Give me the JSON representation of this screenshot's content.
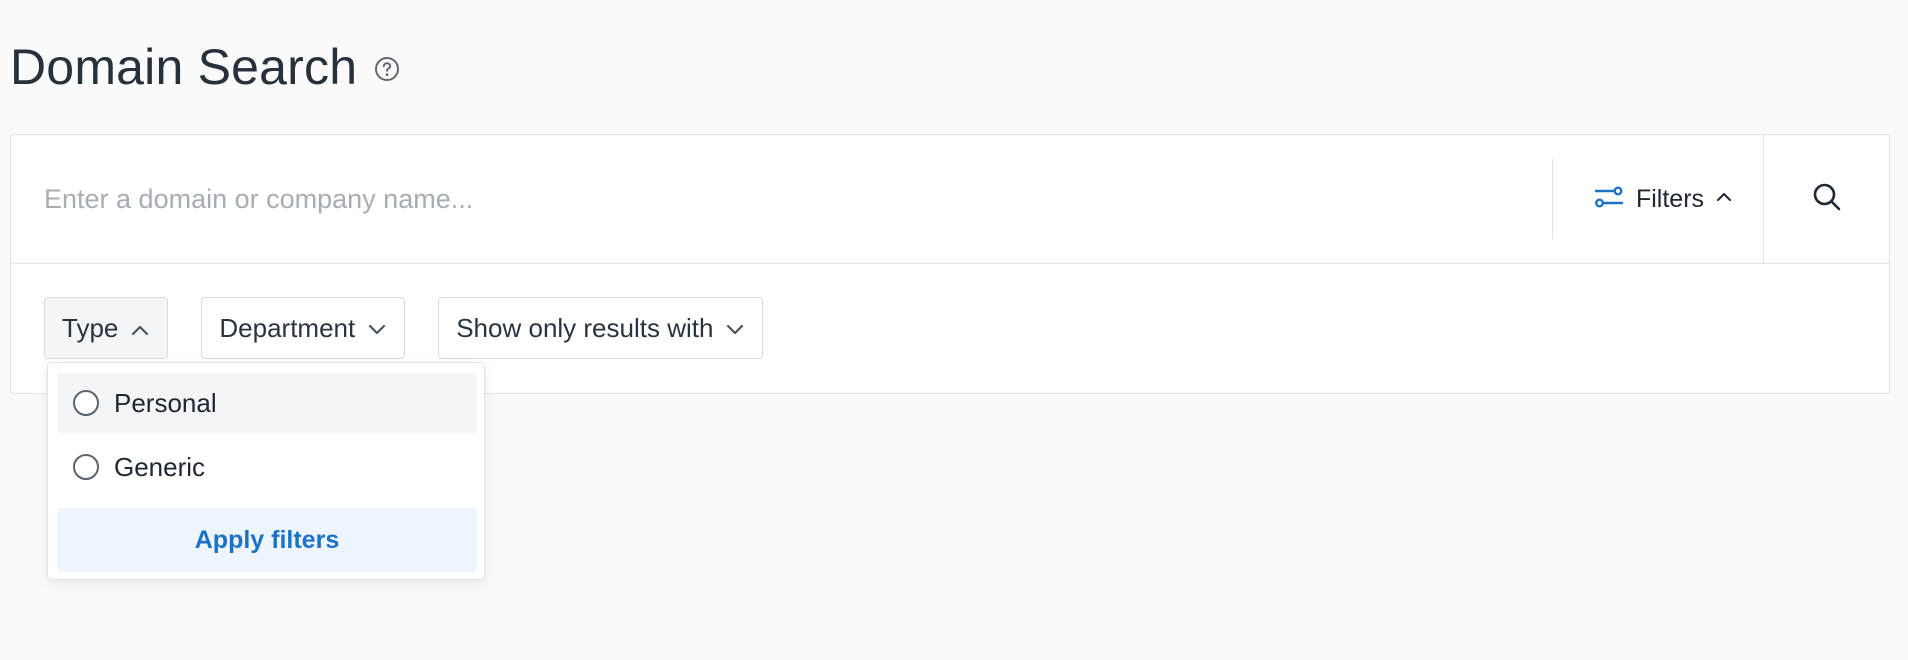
{
  "header": {
    "title": "Domain Search",
    "help_icon": "question-circle-icon"
  },
  "search": {
    "placeholder": "Enter a domain or company name...",
    "value": "",
    "filters_label": "Filters",
    "filters_icon": "sliders-icon",
    "filters_expanded": true,
    "search_icon": "search-icon"
  },
  "filters": {
    "chips": [
      {
        "label": "Type",
        "expanded": true
      },
      {
        "label": "Department",
        "expanded": false
      },
      {
        "label": "Show only results with",
        "expanded": false
      }
    ],
    "type_dropdown": {
      "options": [
        {
          "label": "Personal",
          "selected": false
        },
        {
          "label": "Generic",
          "selected": false
        }
      ],
      "apply_label": "Apply filters"
    }
  },
  "colors": {
    "accent": "#1a73c8",
    "title": "#27313c",
    "background": "#fafafa",
    "border": "#e0e3e7"
  }
}
